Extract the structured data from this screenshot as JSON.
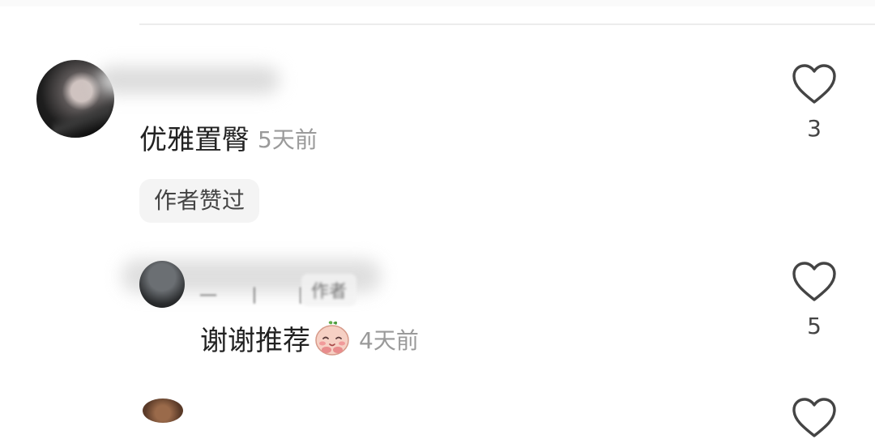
{
  "comments": [
    {
      "text": "优雅置臀",
      "time": "5天前",
      "badge": "作者赞过",
      "likes": "3"
    },
    {
      "reply_name_partial": "一 丨 丨",
      "author_tag": "作者",
      "text": "谢谢推荐",
      "emoji": "blushing-face-emoji",
      "time": "4天前",
      "likes": "5"
    }
  ],
  "icons": {
    "like": "heart-icon"
  },
  "colors": {
    "text": "#222222",
    "muted": "#9a9a9a",
    "chip_bg": "#f4f4f4",
    "heart_stroke": "#444444"
  }
}
